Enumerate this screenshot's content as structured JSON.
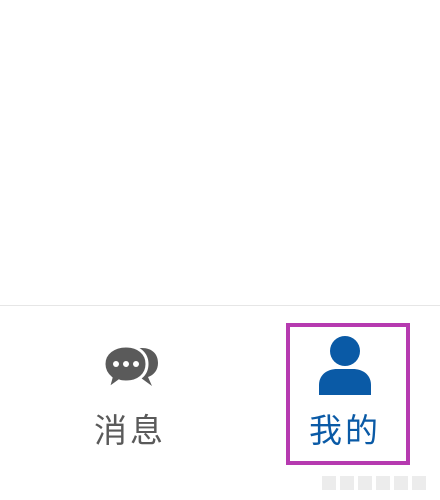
{
  "tabbar": {
    "tabs": [
      {
        "label": "消息",
        "icon": "chat-bubbles-icon",
        "active": false,
        "color": "#5a5a5a"
      },
      {
        "label": "我的",
        "icon": "user-profile-icon",
        "active": true,
        "color": "#0a5aa6"
      }
    ]
  },
  "highlight": {
    "color": "#b63ab0",
    "target": "tab-mine"
  }
}
